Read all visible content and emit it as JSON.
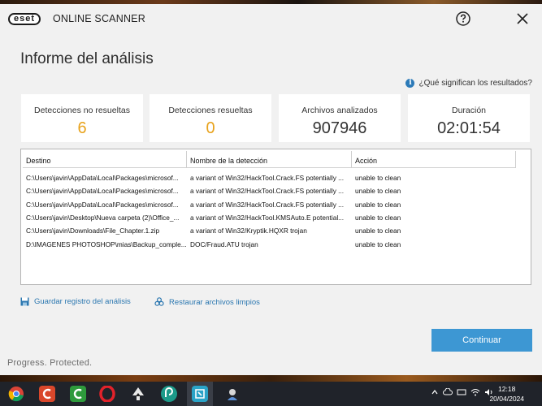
{
  "app": {
    "logo_text": "eset",
    "name": "ONLINE SCANNER"
  },
  "page": {
    "title": "Informe del análisis",
    "help_link": "¿Qué significan los resultados?"
  },
  "stats": [
    {
      "label": "Detecciones no resueltas",
      "value": "6"
    },
    {
      "label": "Detecciones resueltas",
      "value": "0"
    },
    {
      "label": "Archivos analizados",
      "value": "907946"
    },
    {
      "label": "Duración",
      "value": "02:01:54"
    }
  ],
  "colors": {
    "warning": "#e8a21b",
    "accent": "#3d97d3",
    "link": "#2b77b0"
  },
  "table": {
    "columns": [
      "Destino",
      "Nombre de la detección",
      "Acción"
    ],
    "rows": [
      [
        "C:\\Users\\javin\\AppData\\Local\\Packages\\microsof...",
        "a variant of Win32/HackTool.Crack.FS potentially ...",
        "unable to clean"
      ],
      [
        "C:\\Users\\javin\\AppData\\Local\\Packages\\microsof...",
        "a variant of Win32/HackTool.Crack.FS potentially ...",
        "unable to clean"
      ],
      [
        "C:\\Users\\javin\\AppData\\Local\\Packages\\microsof...",
        "a variant of Win32/HackTool.Crack.FS potentially ...",
        "unable to clean"
      ],
      [
        "C:\\Users\\javin\\Desktop\\Nueva carpeta (2)\\Office_...",
        "a variant of Win32/HackTool.KMSAuto.E potential...",
        "unable to clean"
      ],
      [
        "C:\\Users\\javin\\Downloads\\File_Chapter.1.zip",
        "a variant of Win32/Kryptik.HQXR trojan",
        "unable to clean"
      ],
      [
        "D:\\IMAGENES PHOTOSHOP\\mias\\Backup_comple...",
        "DOC/Fraud.ATU trojan",
        "unable to clean"
      ]
    ]
  },
  "actions": {
    "save_log": "Guardar registro del análisis",
    "restore": "Restaurar archivos limpios",
    "continue": "Continuar"
  },
  "tagline": "Progress. Protected.",
  "taskbar": {
    "icons": [
      "chrome-icon",
      "ccleaner-icon",
      "camtasia-icon",
      "opera-icon",
      "inkscape-icon",
      "edge-like-icon",
      "eset-icon",
      "app-icon"
    ],
    "time": "12:18",
    "date": "20/04/2024"
  }
}
